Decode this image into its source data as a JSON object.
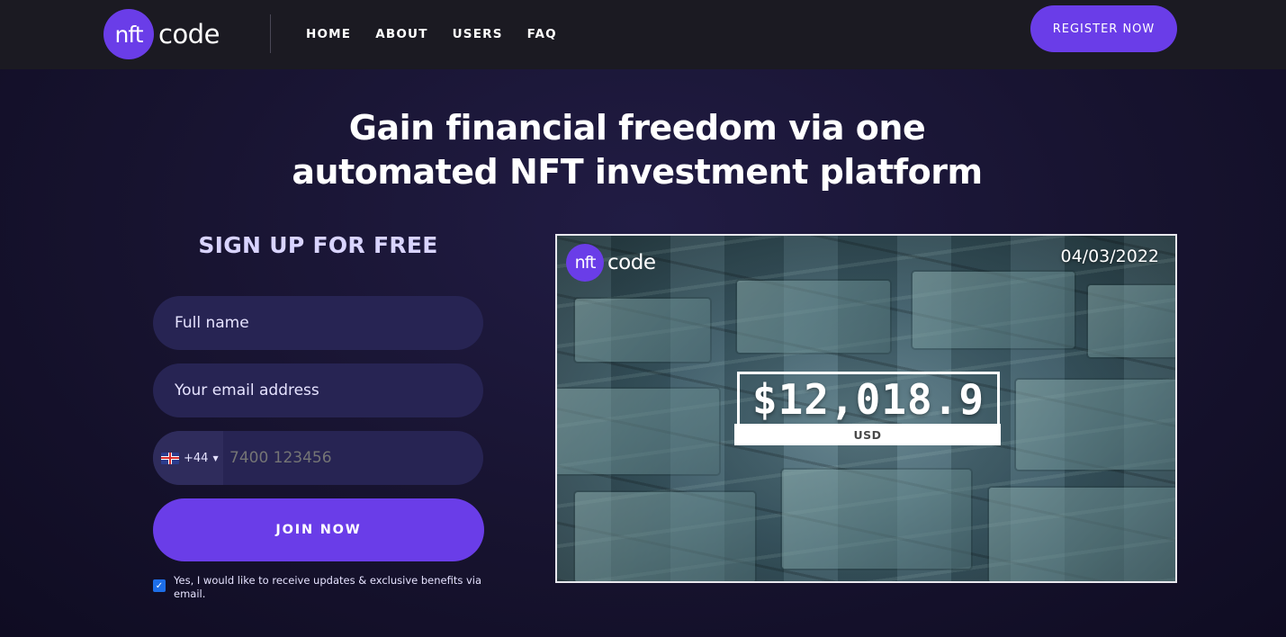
{
  "brand": {
    "logo_mark": "nft",
    "logo_word": "code",
    "accent": "#6a3de8"
  },
  "nav": {
    "items": [
      {
        "label": "HOME"
      },
      {
        "label": "ABOUT"
      },
      {
        "label": "USERS"
      },
      {
        "label": "FAQ"
      }
    ]
  },
  "header": {
    "cta_label": "REGISTER NOW"
  },
  "hero": {
    "title_line1": "Gain financial freedom via one",
    "title_line2": "automated NFT investment platform"
  },
  "signup": {
    "title": "SIGN UP FOR FREE",
    "name_placeholder": "Full name",
    "email_placeholder": "Your email address",
    "phone": {
      "country_code": "+44",
      "flag_icon": "uk-flag-icon",
      "placeholder": "7400 123456"
    },
    "submit_label": "JOIN NOW",
    "consent_checked": true,
    "consent_text": "Yes, I would like to receive updates & exclusive benefits via email."
  },
  "panel": {
    "date": "04/03/2022",
    "amount": "$12,018.9",
    "currency": "USD"
  }
}
